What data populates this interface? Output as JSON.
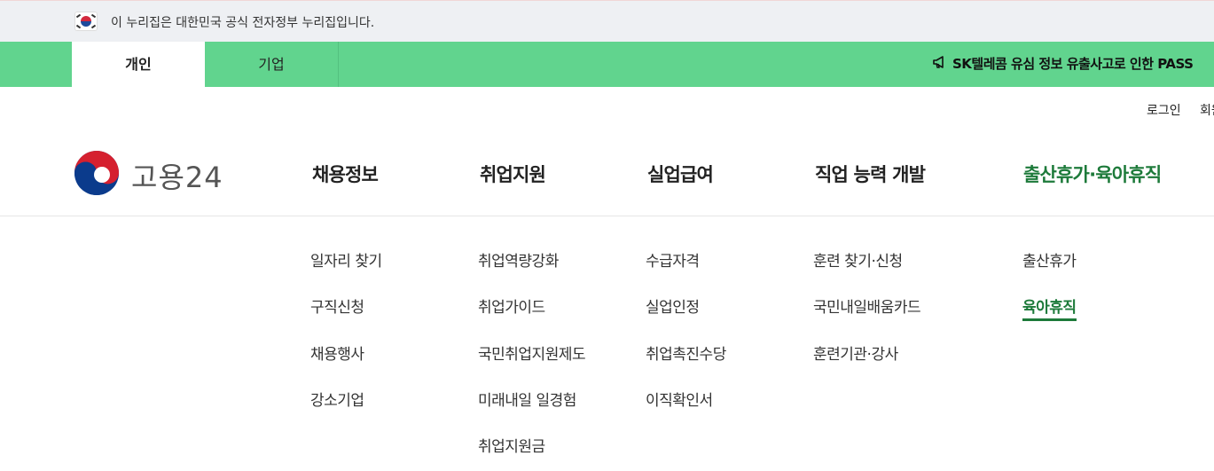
{
  "gov_banner": {
    "text": "이 누리집은 대한민국 공식 전자정부 누리집입니다."
  },
  "tabs": [
    {
      "label": "개인",
      "active": true
    },
    {
      "label": "기업",
      "active": false
    }
  ],
  "notice": {
    "text": "SK텔레콤 유심 정보 유출사고로 인한 PASS"
  },
  "utility": {
    "login": "로그인",
    "join": "회원가입"
  },
  "logo": {
    "text": "고용24"
  },
  "gnb": [
    {
      "label": "채용정보",
      "items": [
        "일자리 찾기",
        "구직신청",
        "채용행사",
        "강소기업"
      ]
    },
    {
      "label": "취업지원",
      "items": [
        "취업역량강화",
        "취업가이드",
        "국민취업지원제도",
        "미래내일 일경험",
        "취업지원금"
      ]
    },
    {
      "label": "실업급여",
      "items": [
        "수급자격",
        "실업인정",
        "취업촉진수당",
        "이직확인서"
      ]
    },
    {
      "label": "직업 능력 개발",
      "items": [
        "훈련 찾기·신청",
        "국민내일배움카드",
        "훈련기관·강사"
      ]
    },
    {
      "label": "출산휴가·육아휴직",
      "active": true,
      "items": [
        "출산휴가",
        "육아휴직"
      ],
      "active_item": "육아휴직"
    }
  ],
  "colors": {
    "tabbar": "#61d48e",
    "accent": "#1d7a3a",
    "banner_bg": "#eef0f3"
  }
}
